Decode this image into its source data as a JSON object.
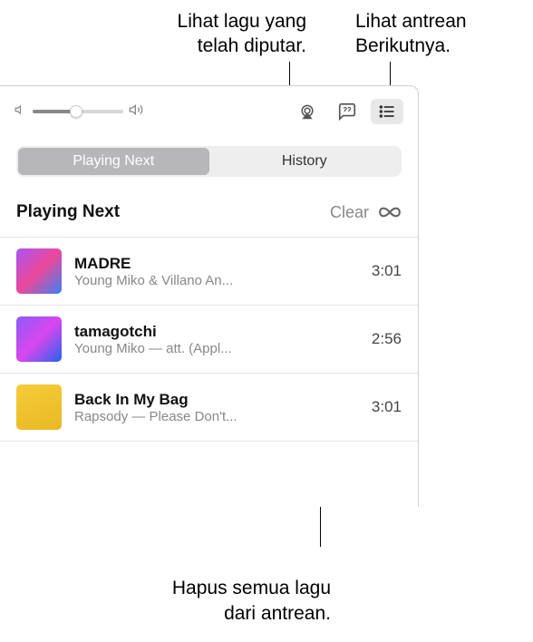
{
  "callouts": {
    "history": "Lihat lagu yang\ntelah diputar.",
    "queue": "Lihat antrean\nBerikutnya.",
    "clear": "Hapus semua lagu\ndari antrean."
  },
  "toolbar": {
    "volume_percent": 48
  },
  "tabs": {
    "playing_next": "Playing Next",
    "history": "History"
  },
  "section": {
    "title": "Playing Next",
    "clear_label": "Clear"
  },
  "songs": [
    {
      "title": "MADRE",
      "artist": "Young Miko & Villano An...",
      "duration": "3:01"
    },
    {
      "title": "tamagotchi",
      "artist": "Young Miko — att. (Appl...",
      "duration": "2:56"
    },
    {
      "title": "Back In My Bag",
      "artist": "Rapsody — Please Don't...",
      "duration": "3:01"
    }
  ]
}
